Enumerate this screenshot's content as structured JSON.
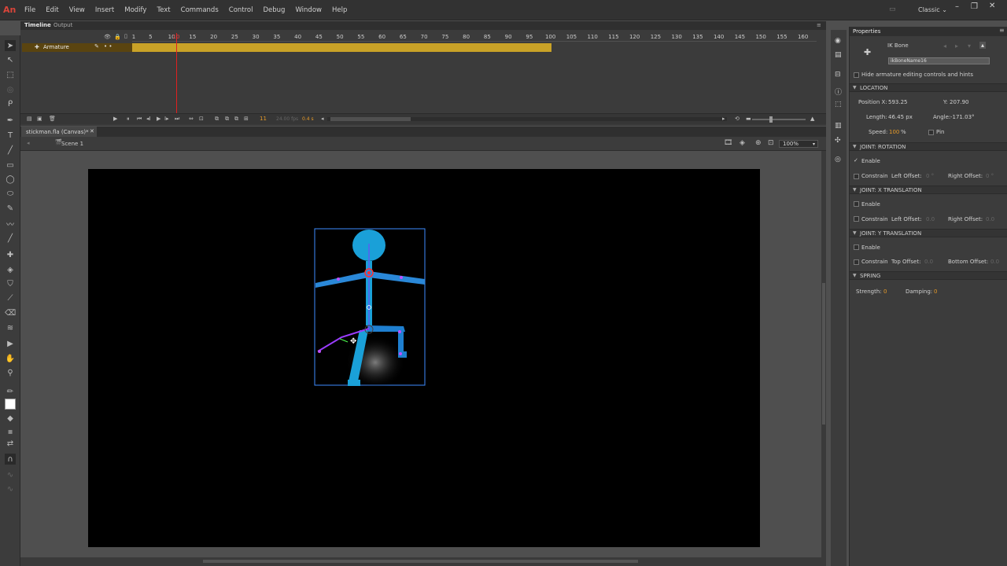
{
  "app": {
    "logo": "An",
    "workspace": "Classic ⌄"
  },
  "menu": [
    "File",
    "Edit",
    "View",
    "Insert",
    "Modify",
    "Text",
    "Commands",
    "Control",
    "Debug",
    "Window",
    "Help"
  ],
  "timeline": {
    "tabs": [
      "Timeline",
      "Output"
    ],
    "ruler_labels": [
      "1",
      "5",
      "10",
      "15",
      "20",
      "25",
      "30",
      "35",
      "40",
      "45",
      "50",
      "55",
      "60",
      "65",
      "70",
      "75",
      "80",
      "85",
      "90",
      "95",
      "100",
      "105",
      "110",
      "115",
      "120",
      "125",
      "130",
      "135",
      "140",
      "145",
      "150",
      "155",
      "160"
    ],
    "layer_name": "Armature",
    "current_frame": "11",
    "fps": "24.00 fps",
    "time": "0.4 s"
  },
  "document": {
    "tab_label": "stickman.fla (Canvas)*",
    "scene": "Scene 1",
    "zoom": "100%"
  },
  "properties": {
    "tab": "Properties",
    "type": "IK Bone",
    "bone_name": "ikBoneName16",
    "hide_armature": "Hide armature editing controls and hints",
    "location": {
      "header": "LOCATION",
      "position_x_label": "Position X:",
      "position_x": "593.25",
      "y_label": "Y:",
      "y": "207.90",
      "length_label": "Length:",
      "length": "46.45 px",
      "angle_label": "Angle:",
      "angle": "-171.03°",
      "speed_label": "Speed:",
      "speed": "100",
      "speed_unit": "%",
      "pin": "Pin"
    },
    "joint_rotation": {
      "header": "JOINT: ROTATION",
      "enable": "Enable",
      "constrain": "Constrain",
      "left_offset": "Left Offset:",
      "left_val": "0 °",
      "right_offset": "Right Offset:",
      "right_val": "0 °"
    },
    "joint_x": {
      "header": "JOINT: X TRANSLATION",
      "enable": "Enable",
      "constrain": "Constrain",
      "left_offset": "Left Offset:",
      "left_val": "0.0",
      "right_offset": "Right Offset:",
      "right_val": "0.0"
    },
    "joint_y": {
      "header": "JOINT: Y TRANSLATION",
      "enable": "Enable",
      "constrain": "Constrain",
      "top_offset": "Top Offset:",
      "top_val": "0.0",
      "bottom_offset": "Bottom Offset:",
      "bottom_val": "0.0"
    },
    "spring": {
      "header": "SPRING",
      "strength_label": "Strength:",
      "strength": "0",
      "damping_label": "Damping:",
      "damping": "0"
    }
  }
}
